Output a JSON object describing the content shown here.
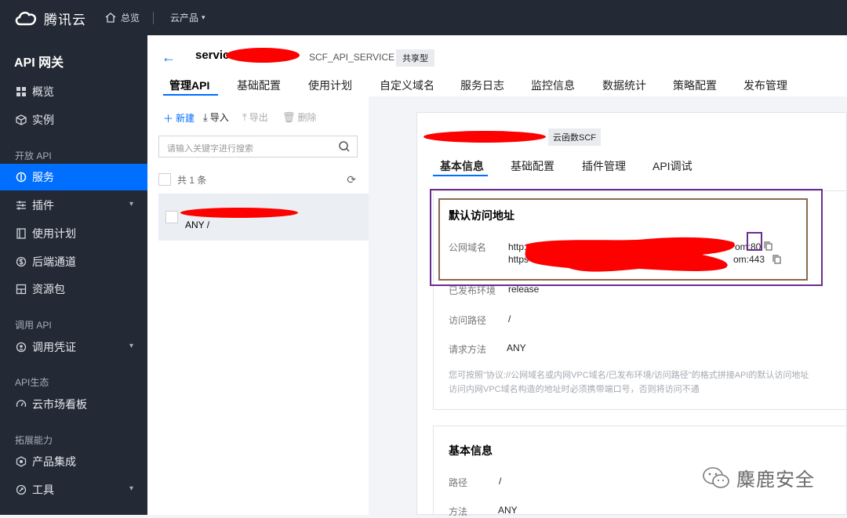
{
  "topbar": {
    "brand": "腾讯云",
    "home_label": "总览",
    "products_label": "云产品"
  },
  "sidebar": {
    "title": "API 网关",
    "items": [
      {
        "label": "概览"
      },
      {
        "label": "实例"
      },
      {
        "label": "服务"
      },
      {
        "label": "插件"
      },
      {
        "label": "使用计划"
      },
      {
        "label": "后端通道"
      },
      {
        "label": "资源包"
      },
      {
        "label": "调用凭证"
      },
      {
        "label": "云市场看板"
      },
      {
        "label": "产品集成"
      },
      {
        "label": "工具"
      }
    ],
    "groups": [
      "开放 API",
      "调用 API",
      "API生态",
      "拓展能力"
    ],
    "active_label": "服务"
  },
  "header": {
    "service_name": "servic",
    "service_id": "SCF_API_SERVICE",
    "service_type": "共享型",
    "tabs": [
      "管理API",
      "基础配置",
      "使用计划",
      "自定义域名",
      "服务日志",
      "监控信息",
      "数据统计",
      "策略配置",
      "发布管理"
    ],
    "active_tab": "管理API"
  },
  "list": {
    "toolbar": {
      "new": "新建",
      "import": "导入",
      "export": "导出",
      "delete": "删除"
    },
    "search_placeholder": "请输入关键字进行搜索",
    "count_text": "共 1 条",
    "rows": [
      {
        "method": "ANY /"
      }
    ]
  },
  "detail": {
    "backend_tag": "云函数SCF",
    "tabs": [
      "基本信息",
      "基础配置",
      "插件管理",
      "API调试"
    ],
    "active_tab": "基本信息",
    "default_access": {
      "title": "默认访问地址",
      "domain_label": "公网域名",
      "url_http_prefix": "http:",
      "url_http_suffix": "om:80",
      "url_https_prefix": "https",
      "url_https_suffix": "om:443",
      "env_label": "已发布环境",
      "env_value": "release",
      "path_label": "访问路径",
      "path_value": "/",
      "method_label": "请求方法",
      "method_value": "ANY",
      "note_line1": "您可按照\"协议://公网域名或内网VPC域名/已发布环境/访问路径\"的格式拼接API的默认访问地址",
      "note_line2": "访问内网VPC域名构造的地址时必须携带端口号，否则将访问不通"
    },
    "basic_info": {
      "title": "基本信息",
      "path_label": "路径",
      "path_value": "/",
      "method_label": "方法",
      "method_value": "ANY"
    }
  },
  "watermark": "麋鹿安全",
  "colors": {
    "accent": "#006eff",
    "sidebar_bg": "#232a35",
    "redaction": "#fd0000",
    "annotation": "#6a2d8f"
  }
}
